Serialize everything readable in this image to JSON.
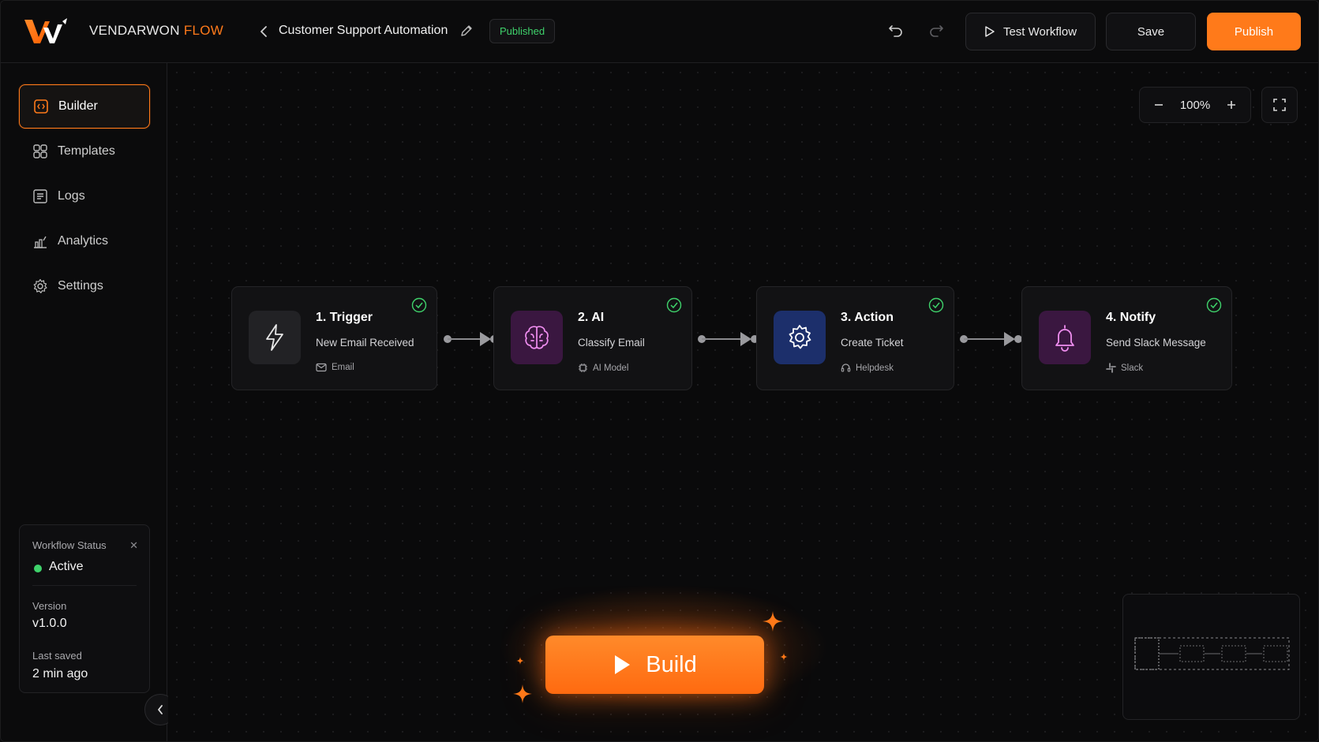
{
  "header": {
    "brand_main": "VENDARWON",
    "brand_accent": "FLOW",
    "workflow_title": "Customer Support Automation",
    "status_badge": "Published",
    "test_label": "Test Workflow",
    "save_label": "Save",
    "publish_label": "Publish"
  },
  "sidebar": {
    "items": [
      {
        "label": "Builder",
        "icon": "builder-icon",
        "active": true
      },
      {
        "label": "Templates",
        "icon": "templates-icon"
      },
      {
        "label": "Logs",
        "icon": "logs-icon"
      },
      {
        "label": "Analytics",
        "icon": "analytics-icon"
      },
      {
        "label": "Settings",
        "icon": "gear-icon"
      }
    ],
    "status_card": {
      "status_label": "Workflow Status",
      "status_value": "Active",
      "version_label": "Version",
      "version_value": "v1.0.0",
      "saved_label": "Last saved",
      "saved_value": "2 min ago"
    }
  },
  "canvas": {
    "zoom": "100%",
    "nodes": [
      {
        "title": "1. Trigger",
        "subtitle": "New Email Received",
        "meta": "Email",
        "icon": "lightning-icon",
        "meta_icon": "mail-icon"
      },
      {
        "title": "2. AI",
        "subtitle": "Classify Email",
        "meta": "AI Model",
        "icon": "brain-icon",
        "meta_icon": "chip-icon"
      },
      {
        "title": "3. Action",
        "subtitle": "Create Ticket",
        "meta": "Helpdesk",
        "icon": "gear-icon",
        "meta_icon": "headset-icon"
      },
      {
        "title": "4. Notify",
        "subtitle": "Send Slack Message",
        "meta": "Slack",
        "icon": "bell-icon",
        "meta_icon": "slack-icon"
      }
    ],
    "build_label": "Build"
  },
  "colors": {
    "accent": "#ff7a1a",
    "success": "#3fd26b",
    "ai_icon_bg": "#3a1740",
    "action_icon_bg": "#1c2f6b",
    "notify_icon_bg": "#3a1740"
  }
}
